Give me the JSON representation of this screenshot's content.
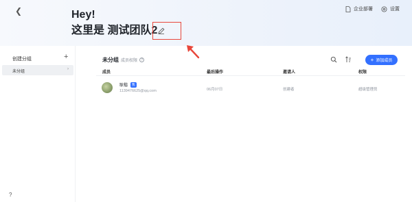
{
  "header": {
    "greeting": "Hey!",
    "team_title": "这里是 测试团队2",
    "actions": [
      {
        "label": "企业部署",
        "icon": "document-icon"
      },
      {
        "label": "设置",
        "icon": "gear-icon"
      }
    ]
  },
  "sidebar": {
    "heading": "创建分组",
    "add_symbol": "+",
    "items": [
      {
        "label": "未分组"
      }
    ]
  },
  "main": {
    "group_title": "未分组",
    "permission_link": "成员权限",
    "add_member_label": "添加成员",
    "columns": [
      "成员",
      "最后操作",
      "邀请人",
      "权限"
    ],
    "rows": [
      {
        "name": "耿楷",
        "badge": "我",
        "email": "1139476625@qq.com",
        "last_action": "06月07日",
        "inviter": "创建者",
        "permission": "超级管理员"
      }
    ]
  },
  "help_label": "?",
  "colors": {
    "accent": "#3370ff",
    "highlight": "#e8463a"
  }
}
